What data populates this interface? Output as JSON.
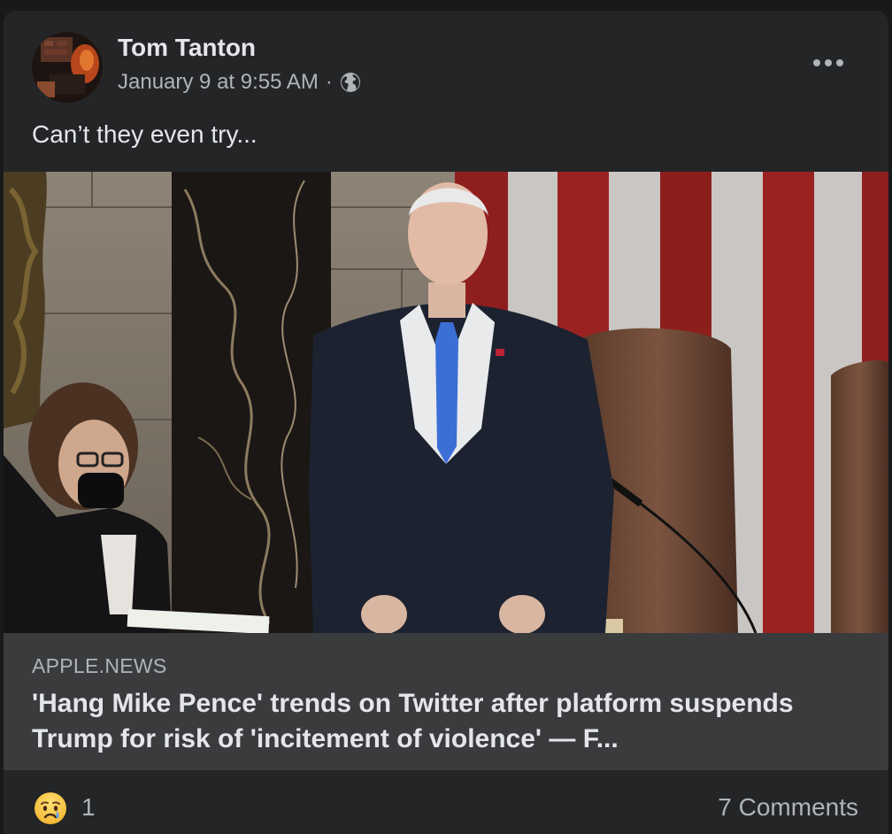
{
  "post": {
    "author": "Tom Tanton",
    "date": "January 9 at 9:55 AM",
    "separator": "·",
    "privacy_icon": "globe-icon",
    "more_icon": "more-options-icon",
    "text": "Can’t they even try..."
  },
  "link_preview": {
    "domain": "APPLE.NEWS",
    "headline": "'Hang Mike Pence' trends on Twitter after platform suspends Trump for risk of 'incitement of violence' — F..."
  },
  "reactions": {
    "icon": "sad-reaction-icon",
    "count": "1",
    "comments": "7 Comments"
  },
  "colors": {
    "background": "#18191a",
    "card": "#242526",
    "link_box": "#3a3b3c",
    "primary_text": "#e4e6eb",
    "secondary_text": "#b0b3b8"
  }
}
